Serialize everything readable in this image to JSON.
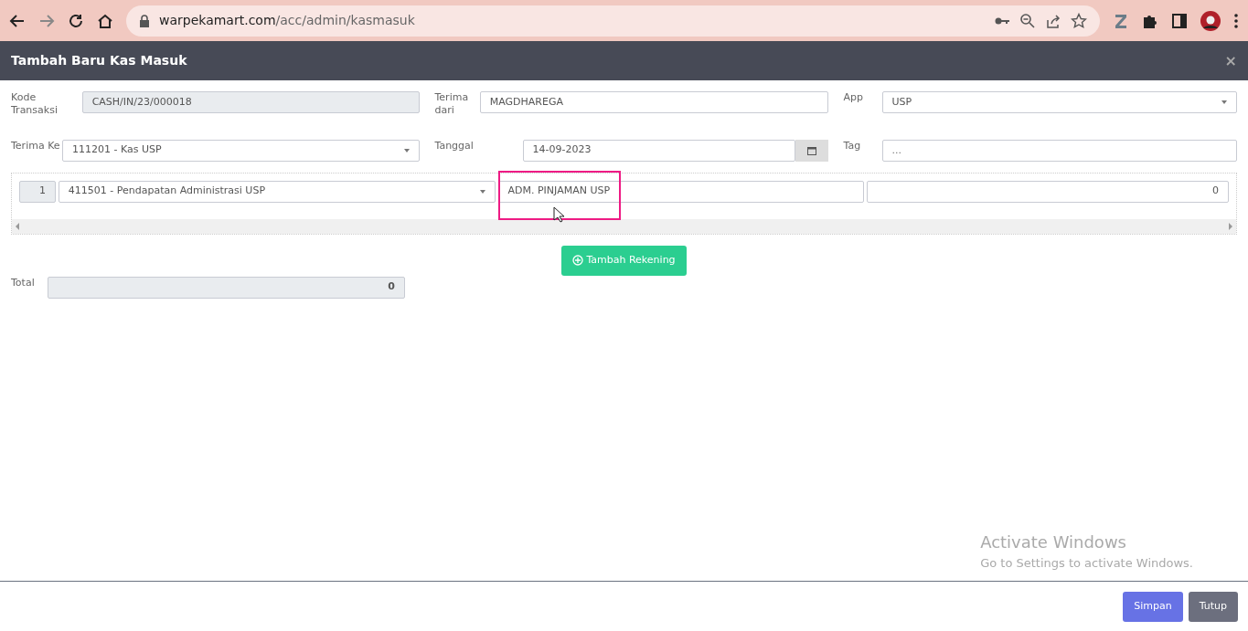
{
  "browser": {
    "url_host": "warpekamart.com",
    "url_path": "/acc/admin/kasmasuk"
  },
  "modal": {
    "title": "Tambah Baru Kas Masuk",
    "close": "×"
  },
  "form": {
    "kode_transaksi": {
      "label": "Kode Transaksi",
      "value": "CASH/IN/23/000018"
    },
    "terima_dari": {
      "label": "Terima dari",
      "value": "MAGDHAREGA"
    },
    "app": {
      "label": "App",
      "value": "USP"
    },
    "terima_ke": {
      "label": "Terima Ke",
      "value": "111201 - Kas USP"
    },
    "tanggal": {
      "label": "Tanggal",
      "value": "14-09-2023"
    },
    "tag": {
      "label": "Tag",
      "placeholder": "..."
    }
  },
  "rows": [
    {
      "number": "1",
      "account": "411501 - Pendapatan Administrasi USP",
      "description": "ADM. PINJAMAN USP",
      "amount": "0",
      "highlighted": true
    }
  ],
  "add_button": "Tambah Rekening",
  "total": {
    "label": "Total",
    "value": "0"
  },
  "footer": {
    "buttons": [
      {
        "label": "Simpan",
        "kind": "primary"
      },
      {
        "label": "Tutup",
        "kind": "secondary"
      }
    ]
  },
  "os_notice": {
    "title": "Activate Windows",
    "text": "Go to Settings to activate Windows."
  }
}
